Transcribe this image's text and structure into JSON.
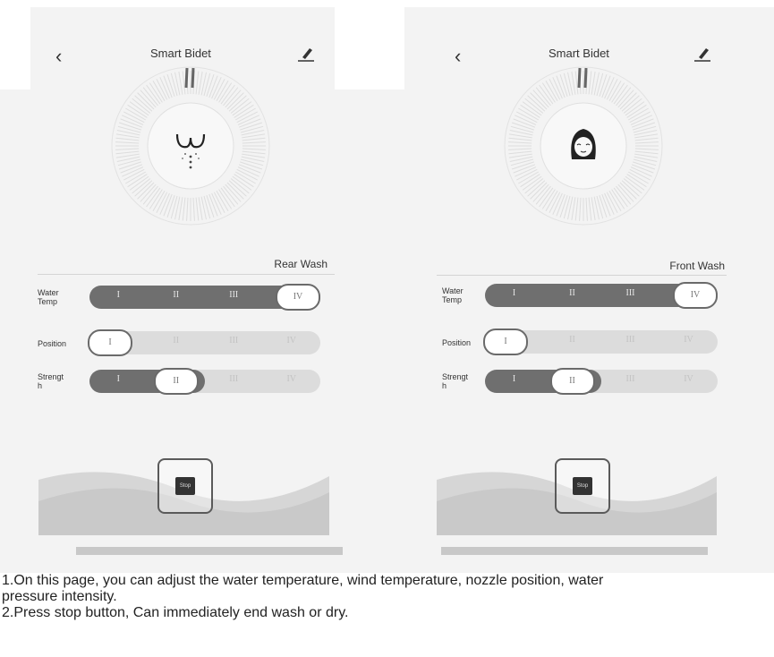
{
  "screens": [
    {
      "title": "Smart Bidet",
      "back_icon": "‹",
      "mode_label": "Rear Wash",
      "dial_icon": "rear-wash-icon",
      "rows": [
        {
          "label": "Water\nTemp",
          "level": 4,
          "ticks": [
            "I",
            "II",
            "III",
            "IV"
          ]
        },
        {
          "label": "Position",
          "level": 1,
          "ticks": [
            "I",
            "II",
            "III",
            "IV"
          ]
        },
        {
          "label": "Strengt\nh",
          "level": 2,
          "ticks": [
            "I",
            "II",
            "III",
            "IV"
          ]
        }
      ],
      "stop_label": "Stop"
    },
    {
      "title": "Smart Bidet",
      "back_icon": "‹",
      "mode_label": "Front Wash",
      "dial_icon": "front-wash-icon",
      "rows": [
        {
          "label": "Water\nTemp",
          "level": 4,
          "ticks": [
            "I",
            "II",
            "III",
            "IV"
          ]
        },
        {
          "label": "Position",
          "level": 1,
          "ticks": [
            "I",
            "II",
            "III",
            "IV"
          ]
        },
        {
          "label": "Strengt\nh",
          "level": 2,
          "ticks": [
            "I",
            "II",
            "III",
            "IV"
          ]
        }
      ],
      "stop_label": "Stop"
    }
  ],
  "instructions": [
    "1.On this page, you can adjust the water temperature, wind temperature, nozzle position, water",
    "   pressure intensity.",
    "2.Press stop button, Can immediately end wash or dry."
  ],
  "colors": {
    "accent": "#6f6f6f",
    "track": "#dcdcdc",
    "background": "#f3f3f3"
  }
}
